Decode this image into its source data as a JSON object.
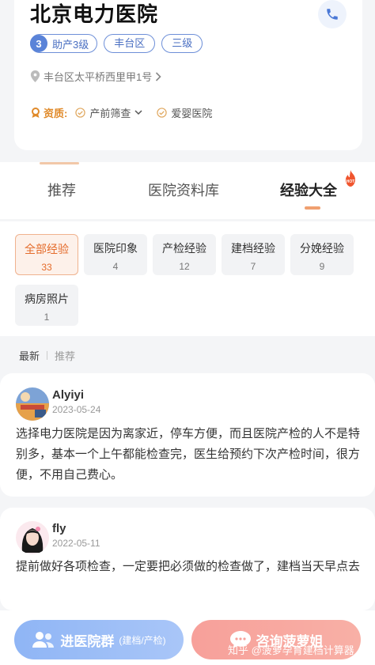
{
  "hospital": {
    "name": "北京电力医院",
    "level_num": "3",
    "level_label": "助产3级",
    "district": "丰台区",
    "grade": "三级",
    "address": "丰台区太平桥西里甲1号",
    "quals_label": "资质:",
    "quals": [
      "产前筛查",
      "爱婴医院"
    ]
  },
  "tabs": [
    "推荐",
    "医院资料库",
    "经验大全"
  ],
  "hot_badge": "HOT",
  "filters": [
    {
      "label": "全部经验",
      "count": "33"
    },
    {
      "label": "医院印象",
      "count": "4"
    },
    {
      "label": "产检经验",
      "count": "12"
    },
    {
      "label": "建档经验",
      "count": "7"
    },
    {
      "label": "分娩经验",
      "count": "9"
    },
    {
      "label": "病房照片",
      "count": "1"
    }
  ],
  "sort": {
    "latest": "最新",
    "recommended": "推荐"
  },
  "posts": [
    {
      "user": "Alyiyi",
      "date": "2023-05-24",
      "text": "选择电力医院是因为离家近，停车方便，而且医院产检的人不是特别多，基本一个上午都能检查完，医生给预约下次产检时间，很方便，不用自己费心。"
    },
    {
      "user": "fly",
      "date": "2022-05-11",
      "text": "提前做好各项检查，一定要把必须做的检查做了，建档当天早点去"
    }
  ],
  "bottom": {
    "group_label": "进医院群",
    "group_sub": "(建档/产检)",
    "consult_label": "咨询菠萝姐"
  },
  "watermark": "知乎 @菠萝孕育建档计算器",
  "colors": {
    "accent": "#e46b2a",
    "blue": "#5a83d8",
    "qual": "#e08a2a"
  }
}
